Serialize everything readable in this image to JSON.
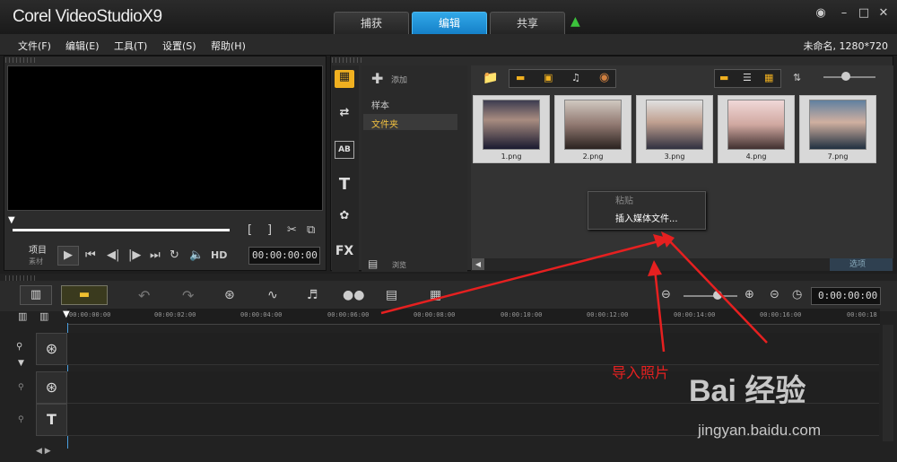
{
  "app": {
    "logo": "Corel VideoStudioX9"
  },
  "tabs": [
    {
      "label": "捕获"
    },
    {
      "label": "编辑"
    },
    {
      "label": "共享"
    }
  ],
  "menu": [
    "文件(F)",
    "编辑(E)",
    "工具(T)",
    "设置(S)",
    "帮助(H)"
  ],
  "project_info": "未命名, 1280*720",
  "preview": {
    "timecode": "00:00:00:00",
    "mode_project": "项目",
    "mode_clip": "素材",
    "hd": "HD"
  },
  "library": {
    "add_label": "添加",
    "nav_items": [
      "样本",
      "文件夹"
    ],
    "browse_label": "浏览",
    "options_label": "选项",
    "thumbnails": [
      "1.png",
      "2.png",
      "3.png",
      "4.png",
      "7.png"
    ]
  },
  "context_menu": {
    "items": [
      "粘贴",
      "插入媒体文件..."
    ]
  },
  "timeline": {
    "timecode": "0:00:00:00",
    "ruler_ticks": [
      "00:00:00:00",
      "00:00:02:00",
      "00:00:04:00",
      "00:00:06:00",
      "00:00:08:00",
      "00:00:10:00",
      "00:00:12:00",
      "00:00:14:00",
      "00:00:16:00",
      "00:00:18"
    ]
  },
  "annotation": "导入照片",
  "watermark": {
    "brand": "Bai 经验",
    "url": "jingyan.baidu.com"
  },
  "colors": {
    "accent": "#1e90e0",
    "annotation": "#e62020"
  }
}
